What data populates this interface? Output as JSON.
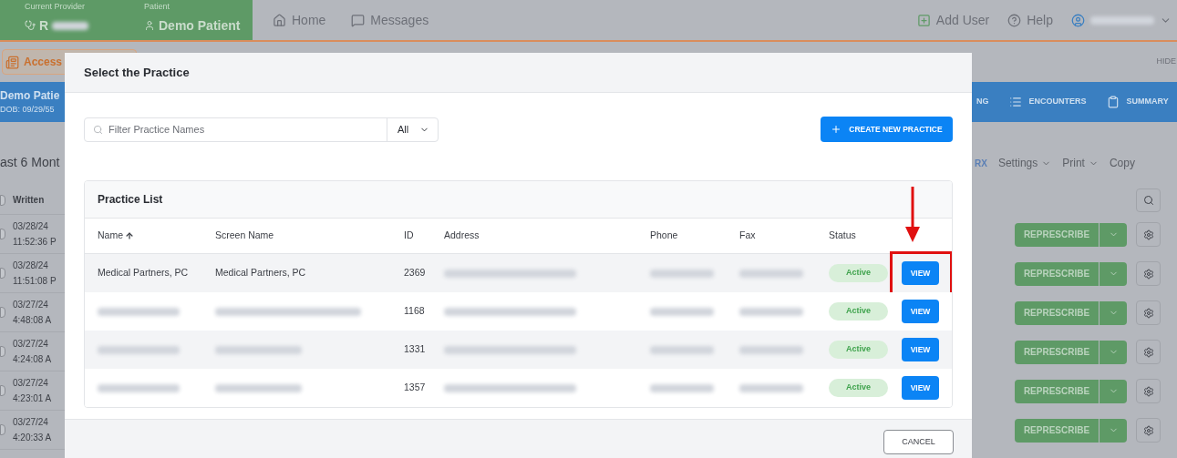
{
  "nav": {
    "provider_label": "Current Provider",
    "provider": "R",
    "patient_label": "Patient",
    "patient": "Demo Patient",
    "links": [
      "Home",
      "Messages"
    ],
    "add_user": "Add User",
    "help": "Help"
  },
  "subbar": {
    "access": "Access",
    "hide": "HIDE"
  },
  "patient_bar": {
    "name": "Demo Patie",
    "dob": "DOB: 09/29/55",
    "tabs": [
      "NG",
      "ENCOUNTERS",
      "SUMMARY"
    ]
  },
  "rx_panel": {
    "title": "ast 6 Mont",
    "column": "Written",
    "all_checked": false,
    "link": "RX",
    "menus": [
      "Settings",
      "Print"
    ],
    "copy": "Copy",
    "rows": [
      {
        "date": "03/28/24",
        "time": "11:52:36 P",
        "action": "REPRESCRIBE",
        "checked": false
      },
      {
        "date": "03/28/24",
        "time": "11:51:08 P",
        "action": "REPRESCRIBE",
        "checked": false
      },
      {
        "date": "03/27/24",
        "time": "4:48:08 A",
        "action": "REPRESCRIBE",
        "checked": false
      },
      {
        "date": "03/27/24",
        "time": "4:24:08 A",
        "action": "REPRESCRIBE",
        "checked": false
      },
      {
        "date": "03/27/24",
        "time": "4:23:01 A",
        "action": "REPRESCRIBE",
        "checked": false
      },
      {
        "date": "03/27/24",
        "time": "4:20:33 A",
        "action": "REPRESCRIBE",
        "checked": false
      }
    ]
  },
  "dialog": {
    "title": "Select the Practice",
    "search_placeholder": "Filter Practice Names",
    "filter": "All",
    "create": "CREATE NEW PRACTICE",
    "list_title": "Practice List",
    "columns": [
      {
        "label": "Name",
        "sorted": true
      },
      {
        "label": "Screen Name",
        "sorted": false
      },
      {
        "label": "ID",
        "sorted": false
      },
      {
        "label": "Address",
        "sorted": false
      },
      {
        "label": "Phone",
        "sorted": false
      },
      {
        "label": "Fax",
        "sorted": false
      },
      {
        "label": "Status",
        "sorted": false
      }
    ],
    "rows": [
      {
        "name": "Medical Partners, PC",
        "screen_name": "Medical Partners, PC",
        "id": "2369",
        "status": "Active",
        "action": "VIEW",
        "annotated": true
      },
      {
        "id": "1168",
        "status": "Active",
        "action": "VIEW",
        "annotated": false
      },
      {
        "id": "1331",
        "status": "Active",
        "action": "VIEW",
        "annotated": false
      },
      {
        "id": "1357",
        "status": "Active",
        "action": "VIEW",
        "annotated": false
      }
    ],
    "cancel": "CANCEL"
  }
}
